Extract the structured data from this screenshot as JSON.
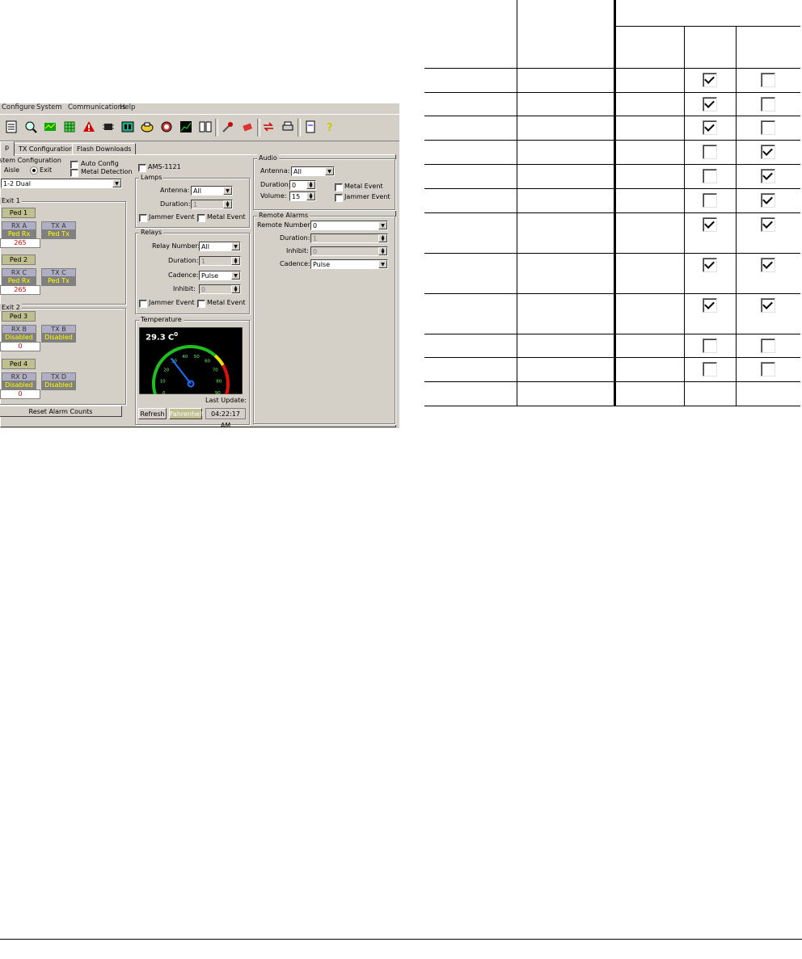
{
  "screenshot": {
    "menu": {
      "configure": "Configure",
      "system": "System",
      "communications": "Communications",
      "help": "Help"
    },
    "toolbar_icons": [
      "settings-icon",
      "magnify-icon",
      "map-icon",
      "grid-icon",
      "alert-icon",
      "chip-icon",
      "board-icon",
      "device-icon",
      "alarm-icon",
      "chart-icon",
      "document-icon",
      "tools-icon",
      "eraser-icon",
      "swap-icon",
      "print-icon",
      "page-icon",
      "help-icon"
    ],
    "tabs": [
      "p",
      "TX Configuration",
      "Flash Downloads"
    ],
    "system_config": {
      "legend": "stem Configuration",
      "aisle": "Aisle",
      "exit": "Exit",
      "auto_config": "Auto Config",
      "metal_detection": "Metal Detection",
      "mode": "1-2 Dual"
    },
    "exit1": {
      "legend": "Exit 1",
      "ped1": "Ped 1",
      "ped2": "Ped 2",
      "rxa": {
        "h": "RX A",
        "v": "Ped Rx"
      },
      "txa": {
        "h": "TX A",
        "v": "Ped Tx"
      },
      "count1": "265",
      "rxc": {
        "h": "RX C",
        "v": "Ped Rx"
      },
      "txc": {
        "h": "TX C",
        "v": "Ped Tx"
      },
      "count2": "265"
    },
    "exit2": {
      "legend": "Exit 2",
      "ped3": "Ped 3",
      "ped4": "Ped 4",
      "rxb": {
        "h": "RX B",
        "v": "Disabled"
      },
      "txb": {
        "h": "TX B",
        "v": "Disabled"
      },
      "count3": "0",
      "rxd": {
        "h": "RX D",
        "v": "Disabled"
      },
      "txd": {
        "h": "TX D",
        "v": "Disabled"
      },
      "count4": "0"
    },
    "reset_button": "Reset Alarm Counts",
    "ams": "AMS-1121",
    "lamps": {
      "legend": "Lamps",
      "antenna_label": "Antenna:",
      "antenna": "All",
      "duration_label": "Duration:",
      "duration": "1",
      "jammer": "Jammer Event",
      "metal": "Metal Event"
    },
    "relays": {
      "legend": "Relays",
      "relay_number_label": "Relay Number:",
      "relay_number": "All",
      "duration_label": "Duration:",
      "duration": "1",
      "cadence_label": "Cadence:",
      "cadence": "Pulse",
      "inhibit_label": "Inhibit:",
      "inhibit": "0",
      "jammer": "Jammer Event",
      "metal": "Metal Event"
    },
    "temperature": {
      "legend": "Temperature",
      "value": "29.3",
      "unit": "C",
      "degree": "0",
      "reading": 29.3,
      "scale": [
        "0",
        "10",
        "20",
        "30",
        "40",
        "50",
        "60",
        "70",
        "80",
        "90"
      ],
      "refresh": "Refresh",
      "fahrenheit": "Fahrenheit",
      "last_update_label": "Last Update:",
      "last_update": "04:22:17 AM"
    },
    "audio": {
      "legend": "Audio",
      "antenna_label": "Antenna:",
      "antenna": "All",
      "duration_label": "Duration:",
      "duration": "0",
      "volume_label": "Volume:",
      "volume": "15",
      "metal": "Metal Event",
      "jammer": "Jammer Event"
    },
    "remote_alarms": {
      "legend": "Remote Alarms",
      "remote_number_label": "Remote Number:",
      "remote_number": "0",
      "duration_label": "Duration:",
      "duration": "1",
      "inhibit_label": "Inhibit:",
      "inhibit": "0",
      "cadence_label": "Cadence:",
      "cadence": "Pulse"
    }
  },
  "table": {
    "rows": [
      {
        "a": true,
        "b": false
      },
      {
        "a": true,
        "b": false
      },
      {
        "a": true,
        "b": false
      },
      {
        "a": false,
        "b": true
      },
      {
        "a": false,
        "b": true
      },
      {
        "a": false,
        "b": true
      },
      {
        "a": true,
        "b": true
      },
      {
        "a": true,
        "b": true
      },
      {
        "a": true,
        "b": true
      },
      {
        "a": false,
        "b": false
      },
      {
        "a": false,
        "b": false
      },
      {
        "a": null,
        "b": null
      }
    ]
  }
}
